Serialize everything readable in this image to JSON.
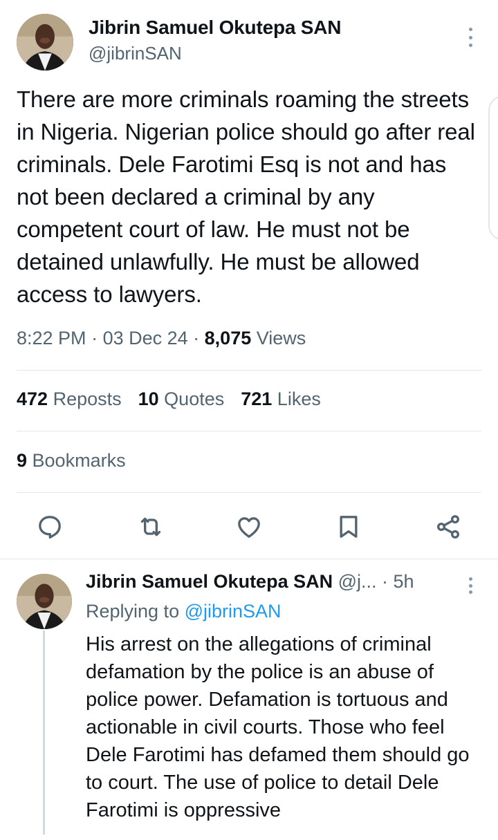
{
  "tweet": {
    "author": {
      "name": "Jibrin Samuel Okutepa SAN",
      "handle": "@jibrinSAN"
    },
    "text": "There are more criminals roaming the streets in Nigeria. Nigerian police should go after real criminals. Dele Farotimi Esq is not and has not been declared a criminal by any competent court of law. He must not be detained unlawfully. He must be allowed access to lawyers.",
    "meta": {
      "time": "8:22 PM",
      "separator": " · ",
      "date": "03 Dec 24",
      "views_count": "8,075",
      "views_label": " Views"
    },
    "stats": {
      "reposts_count": "472",
      "reposts_label": " Reposts",
      "quotes_count": "10",
      "quotes_label": " Quotes",
      "likes_count": "721",
      "likes_label": " Likes",
      "bookmarks_count": "9",
      "bookmarks_label": " Bookmarks"
    },
    "actions": [
      "reply-icon",
      "repost-icon",
      "like-icon",
      "bookmark-icon",
      "share-icon"
    ]
  },
  "reply": {
    "name": "Jibrin Samuel Okutepa SAN",
    "handle": "@j...",
    "time": " · 5h",
    "replying_prefix": "Replying to ",
    "replying_mention": "@jibrinSAN",
    "text": "His arrest on the allegations of criminal defamation by the police is an abuse of police power. Defamation is tortuous and actionable in civil courts. Those who feel Dele Farotimi has defamed them should go to court. The use of police to detail Dele Farotimi is oppressive"
  },
  "colors": {
    "text_primary": "#0f1419",
    "text_secondary": "#536471",
    "link": "#1d9bf0",
    "icon": "#536471",
    "divider": "#e1e6ea"
  }
}
